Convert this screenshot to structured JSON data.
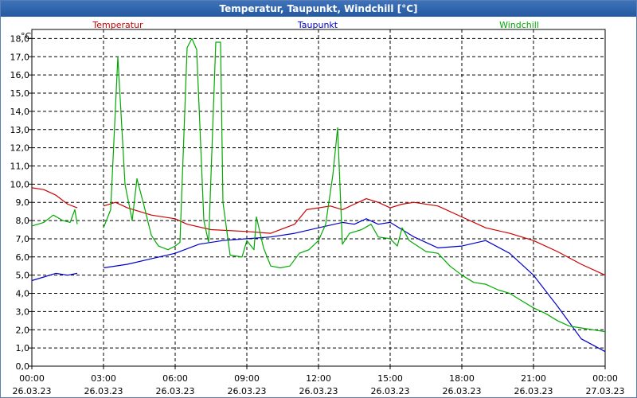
{
  "chart_data": {
    "type": "line",
    "title": "Temperatur, Taupunkt, Windchill [°C]",
    "unit_label": "°C",
    "ylim": [
      0,
      18.5
    ],
    "yticks": [
      "0,0",
      "1,0",
      "2,0",
      "3,0",
      "4,0",
      "5,0",
      "6,0",
      "7,0",
      "8,0",
      "9,0",
      "10,0",
      "11,0",
      "12,0",
      "13,0",
      "14,0",
      "15,0",
      "16,0",
      "17,0",
      "18,0"
    ],
    "xlim": [
      0,
      24
    ],
    "xticks": [
      {
        "time": "00:00",
        "date": "26.03.23"
      },
      {
        "time": "03:00",
        "date": "26.03.23"
      },
      {
        "time": "06:00",
        "date": "26.03.23"
      },
      {
        "time": "09:00",
        "date": "26.03.23"
      },
      {
        "time": "12:00",
        "date": "26.03.23"
      },
      {
        "time": "15:00",
        "date": "26.03.23"
      },
      {
        "time": "18:00",
        "date": "26.03.23"
      },
      {
        "time": "21:00",
        "date": "26.03.23"
      },
      {
        "time": "00:00",
        "date": "27.03.23"
      }
    ],
    "grid": true,
    "series": [
      {
        "name": "Temperatur",
        "color": "#cc0000",
        "segments": [
          [
            [
              0,
              9.8
            ],
            [
              0.5,
              9.7
            ],
            [
              1.0,
              9.4
            ],
            [
              1.5,
              8.9
            ],
            [
              1.9,
              8.7
            ]
          ],
          [
            [
              3.0,
              8.8
            ],
            [
              3.5,
              9.0
            ],
            [
              4.0,
              8.7
            ],
            [
              5.0,
              8.3
            ],
            [
              6.0,
              8.1
            ],
            [
              6.5,
              7.8
            ],
            [
              7.5,
              7.5
            ],
            [
              9.0,
              7.4
            ],
            [
              10.0,
              7.3
            ],
            [
              11.0,
              7.8
            ],
            [
              11.5,
              8.6
            ],
            [
              12.5,
              8.8
            ],
            [
              13.0,
              8.6
            ],
            [
              13.5,
              8.9
            ],
            [
              14.0,
              9.2
            ],
            [
              14.5,
              9.0
            ],
            [
              15.0,
              8.7
            ],
            [
              15.5,
              8.9
            ],
            [
              16.0,
              9.0
            ],
            [
              17.0,
              8.8
            ],
            [
              18.0,
              8.2
            ],
            [
              19.0,
              7.6
            ],
            [
              20.0,
              7.3
            ],
            [
              21.0,
              6.9
            ],
            [
              22.0,
              6.3
            ],
            [
              23.0,
              5.6
            ],
            [
              24.0,
              5.0
            ]
          ]
        ]
      },
      {
        "name": "Taupunkt",
        "color": "#0000cc",
        "segments": [
          [
            [
              0,
              4.7
            ],
            [
              0.5,
              4.9
            ],
            [
              1.0,
              5.1
            ],
            [
              1.5,
              5.0
            ],
            [
              1.9,
              5.1
            ]
          ],
          [
            [
              3.0,
              5.4
            ],
            [
              4.0,
              5.6
            ],
            [
              5.0,
              5.9
            ],
            [
              6.0,
              6.2
            ],
            [
              7.0,
              6.7
            ],
            [
              8.0,
              6.9
            ],
            [
              9.0,
              7.0
            ],
            [
              10.0,
              7.1
            ],
            [
              11.0,
              7.3
            ],
            [
              12.0,
              7.6
            ],
            [
              13.0,
              7.9
            ],
            [
              13.5,
              7.8
            ],
            [
              14.0,
              8.1
            ],
            [
              14.5,
              7.8
            ],
            [
              15.0,
              7.9
            ],
            [
              15.5,
              7.5
            ],
            [
              16.0,
              7.1
            ],
            [
              17.0,
              6.5
            ],
            [
              18.0,
              6.6
            ],
            [
              19.0,
              6.9
            ],
            [
              20.0,
              6.2
            ],
            [
              21.0,
              5.0
            ],
            [
              22.0,
              3.3
            ],
            [
              23.0,
              1.5
            ],
            [
              24.0,
              0.8
            ]
          ]
        ]
      },
      {
        "name": "Windchill",
        "color": "#00aa00",
        "segments": [
          [
            [
              0,
              7.7
            ],
            [
              0.5,
              7.9
            ],
            [
              0.9,
              8.3
            ],
            [
              1.3,
              8.0
            ],
            [
              1.6,
              7.9
            ],
            [
              1.8,
              8.6
            ],
            [
              1.9,
              7.8
            ]
          ],
          [
            [
              3.0,
              7.6
            ],
            [
              3.3,
              8.6
            ],
            [
              3.6,
              17.0
            ],
            [
              3.9,
              10.0
            ],
            [
              4.2,
              8.0
            ],
            [
              4.4,
              10.3
            ],
            [
              4.7,
              8.8
            ],
            [
              5.0,
              7.2
            ],
            [
              5.3,
              6.6
            ],
            [
              5.7,
              6.4
            ],
            [
              6.0,
              6.6
            ],
            [
              6.2,
              6.8
            ],
            [
              6.5,
              17.5
            ],
            [
              6.7,
              18.0
            ],
            [
              6.9,
              17.4
            ],
            [
              7.2,
              8.0
            ],
            [
              7.4,
              6.8
            ],
            [
              7.7,
              17.8
            ],
            [
              7.9,
              17.8
            ],
            [
              8.0,
              9.0
            ],
            [
              8.3,
              6.1
            ],
            [
              8.8,
              6.0
            ],
            [
              9.0,
              6.9
            ],
            [
              9.3,
              6.4
            ],
            [
              9.4,
              8.2
            ],
            [
              9.7,
              6.5
            ],
            [
              10.0,
              5.5
            ],
            [
              10.4,
              5.4
            ],
            [
              10.8,
              5.5
            ],
            [
              11.2,
              6.2
            ],
            [
              11.6,
              6.4
            ],
            [
              12.0,
              6.9
            ],
            [
              12.3,
              7.8
            ],
            [
              12.6,
              10.5
            ],
            [
              12.8,
              13.1
            ],
            [
              13.0,
              6.7
            ],
            [
              13.3,
              7.3
            ],
            [
              13.8,
              7.5
            ],
            [
              14.2,
              7.8
            ],
            [
              14.5,
              7.1
            ],
            [
              15.0,
              7.0
            ],
            [
              15.3,
              6.6
            ],
            [
              15.5,
              7.6
            ],
            [
              15.8,
              6.9
            ],
            [
              16.5,
              6.3
            ],
            [
              17.0,
              6.2
            ],
            [
              17.5,
              5.5
            ],
            [
              18.0,
              5.0
            ],
            [
              18.5,
              4.6
            ],
            [
              19.0,
              4.5
            ],
            [
              19.5,
              4.2
            ],
            [
              20.0,
              4.0
            ],
            [
              20.5,
              3.6
            ],
            [
              21.0,
              3.2
            ],
            [
              21.5,
              2.9
            ],
            [
              22.0,
              2.5
            ],
            [
              22.5,
              2.2
            ],
            [
              23.0,
              2.1
            ],
            [
              23.5,
              2.0
            ],
            [
              24.0,
              1.9
            ]
          ]
        ]
      }
    ]
  }
}
